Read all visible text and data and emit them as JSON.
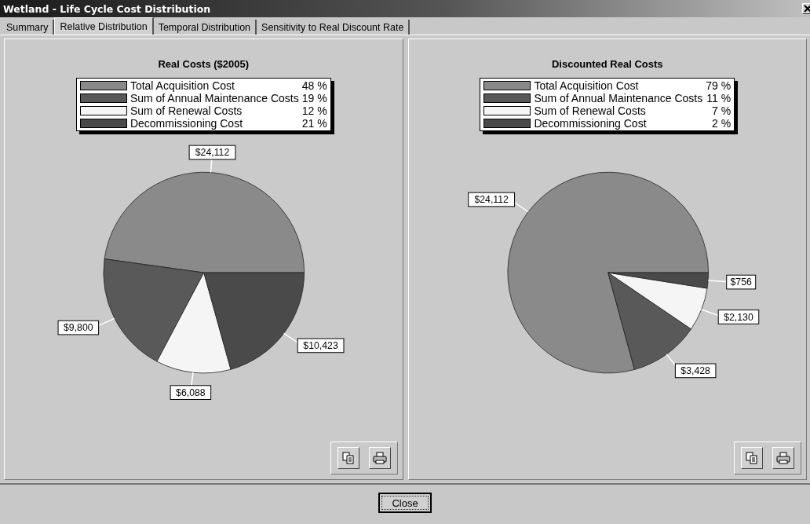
{
  "window": {
    "title": "Wetland - Life Cycle Cost Distribution"
  },
  "tabs": [
    {
      "label": "Summary",
      "selected": false
    },
    {
      "label": "Relative Distribution",
      "selected": true
    },
    {
      "label": "Temporal Distribution",
      "selected": false
    },
    {
      "label": "Sensitivity to Real Discount Rate",
      "selected": false
    }
  ],
  "panels": [
    {
      "title": "Real Costs ($2005)",
      "legend": [
        {
          "percent": "48 %",
          "color": "#8a8a8a"
        },
        {
          "percent": "19 %",
          "color": "#595959"
        },
        {
          "percent": "12 %",
          "color": "#f5f5f5"
        },
        {
          "percent": "21 %",
          "color": "#4a4a4a"
        }
      ],
      "chart_data": {
        "type": "pie",
        "categories": [
          "Total Acquisition Cost",
          "Sum of Annual Maintenance Costs",
          "Sum of Renewal Costs",
          "Decommissioning Cost"
        ],
        "values": [
          24112,
          9800,
          6088,
          10423
        ],
        "data_labels": true,
        "value_labels": [
          "$24,112",
          "$9,800",
          "$6,088",
          "$10,423"
        ]
      }
    },
    {
      "title": "Discounted Real Costs",
      "legend": [
        {
          "percent": "79 %",
          "color": "#8a8a8a"
        },
        {
          "percent": "11 %",
          "color": "#595959"
        },
        {
          "percent": "7 %",
          "color": "#f5f5f5"
        },
        {
          "percent": "2 %",
          "color": "#4a4a4a"
        }
      ],
      "chart_data": {
        "type": "pie",
        "categories": [
          "Total Acquisition Cost",
          "Sum of Annual Maintenance Costs",
          "Sum of Renewal Costs",
          "Decommissioning Cost"
        ],
        "values": [
          24112,
          3428,
          2130,
          756
        ],
        "data_labels": true,
        "value_labels": [
          "$24,112",
          "$3,428",
          "$2,130",
          "$756"
        ]
      }
    }
  ],
  "buttons": [
    {
      "label": "Close"
    }
  ]
}
